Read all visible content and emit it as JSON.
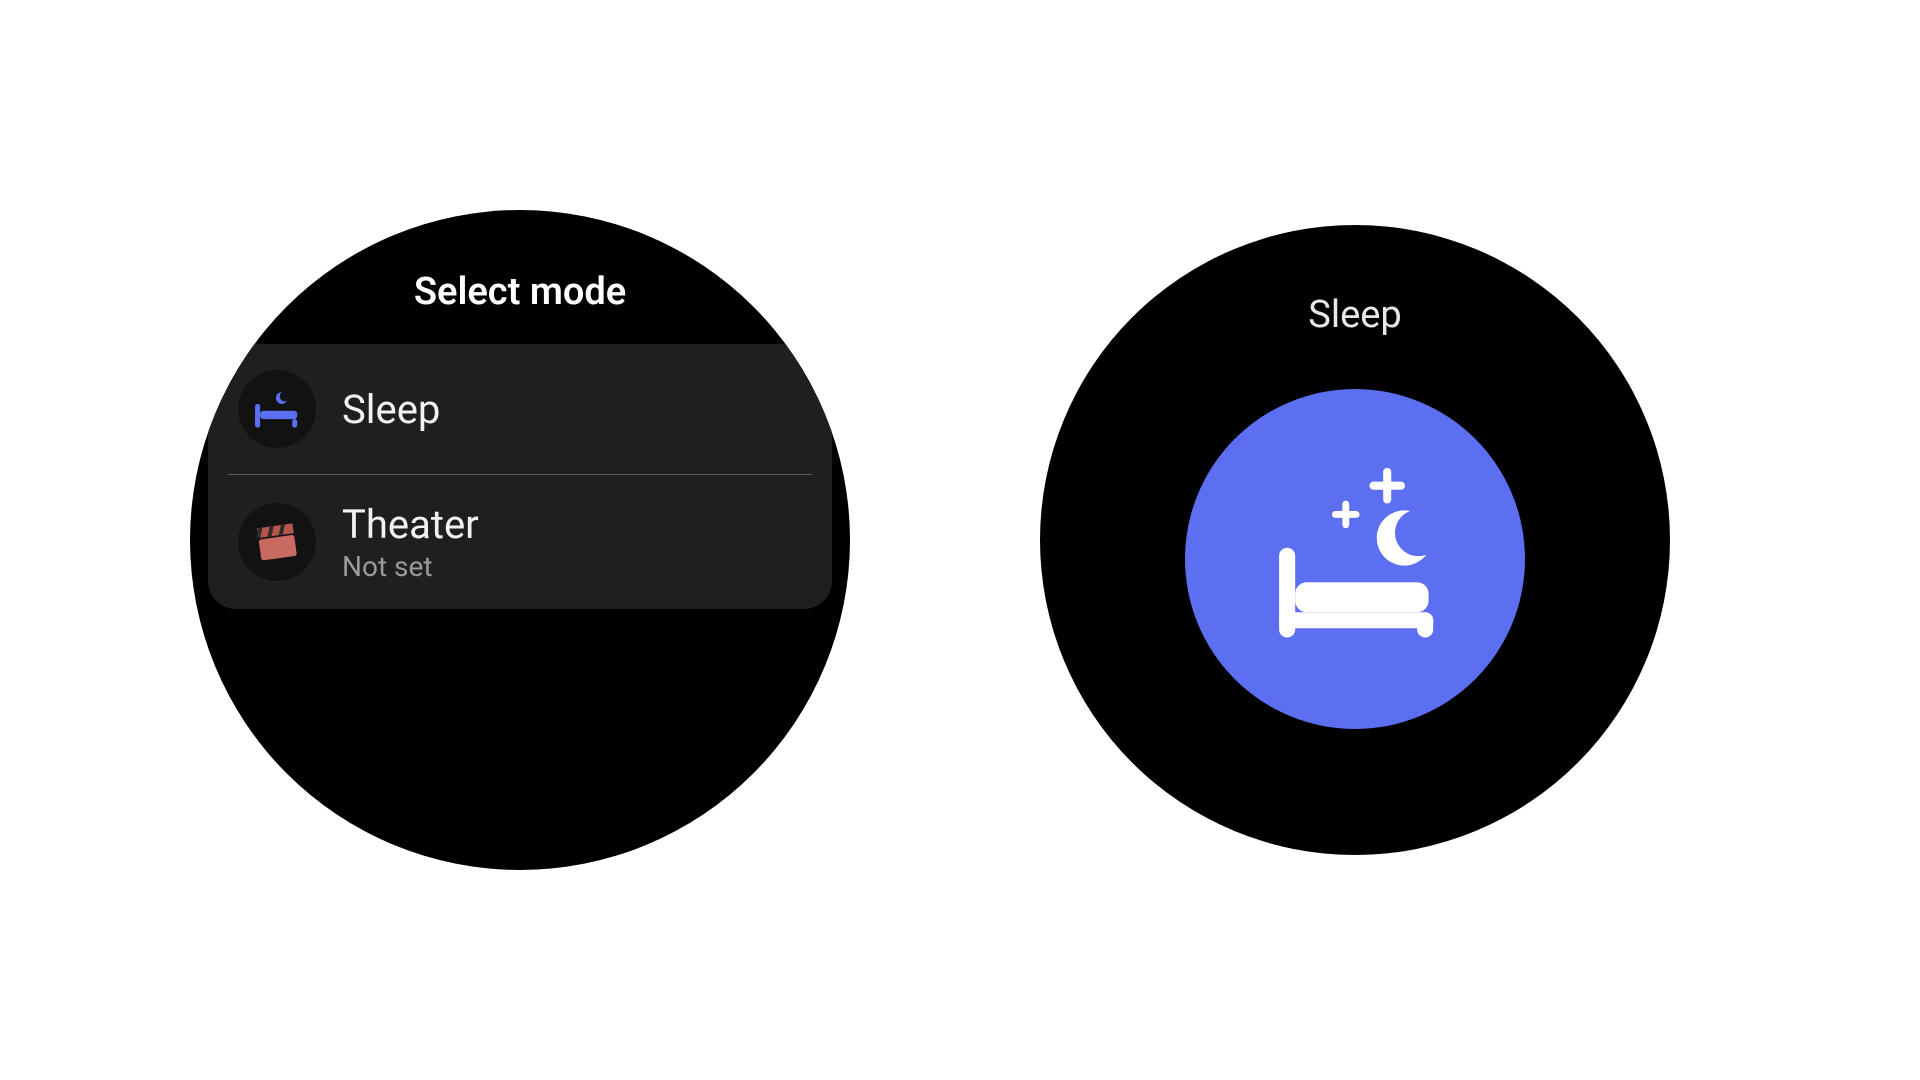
{
  "left": {
    "title": "Select mode",
    "items": [
      {
        "icon": "bed-icon",
        "label": "Sleep",
        "sublabel": ""
      },
      {
        "icon": "clapperboard-icon",
        "label": "Theater",
        "sublabel": "Not set"
      }
    ]
  },
  "right": {
    "title": "Sleep",
    "accent": "#5d6ff1"
  }
}
